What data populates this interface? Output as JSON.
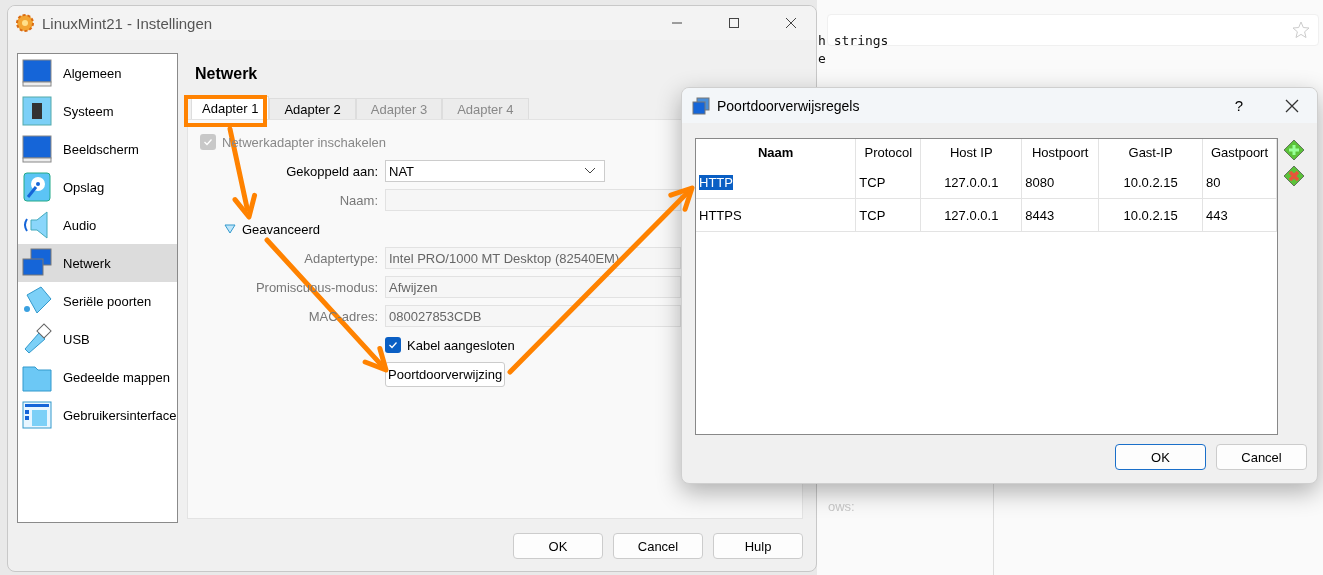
{
  "background": {
    "texts": [
      "h strings",
      "e",
      "ows:"
    ]
  },
  "settings_window": {
    "title": "LinuxMint21 - Instellingen",
    "sidebar": {
      "items": [
        {
          "label": "Algemeen",
          "selected": false
        },
        {
          "label": "Systeem",
          "selected": false
        },
        {
          "label": "Beeldscherm",
          "selected": false
        },
        {
          "label": "Opslag",
          "selected": false
        },
        {
          "label": "Audio",
          "selected": false
        },
        {
          "label": "Netwerk",
          "selected": true
        },
        {
          "label": "Seriële poorten",
          "selected": false
        },
        {
          "label": "USB",
          "selected": false
        },
        {
          "label": "Gedeelde mappen",
          "selected": false
        },
        {
          "label": "Gebruikersinterface",
          "selected": false
        }
      ]
    },
    "section_title": "Netwerk",
    "tabs": [
      {
        "label": "Adapter 1",
        "selected": true,
        "disabled": false
      },
      {
        "label": "Adapter 2",
        "selected": false,
        "disabled": false
      },
      {
        "label": "Adapter 3",
        "selected": false,
        "disabled": true
      },
      {
        "label": "Adapter 4",
        "selected": false,
        "disabled": true
      }
    ],
    "enable_adapter": {
      "label": "Netwerkadapter inschakelen",
      "checked": true,
      "disabled": true
    },
    "fields": [
      {
        "kind": "combo",
        "label": "Gekoppeld aan:",
        "value": "NAT",
        "disabled": false
      },
      {
        "kind": "text",
        "label": "Naam:",
        "disabled": true
      },
      {
        "kind": "expander",
        "label": "Geavanceerd",
        "expanded": true
      },
      {
        "kind": "text",
        "label": "Adaptertype:",
        "value": "Intel PRO/1000 MT Desktop (82540EM)",
        "disabled": true
      },
      {
        "kind": "text",
        "label": "Promiscuous-modus:",
        "value": "Afwijzen",
        "disabled": true
      },
      {
        "kind": "text",
        "label": "MAC-adres:",
        "value": "080027853CDB",
        "disabled": true
      }
    ],
    "cable_connected": {
      "label": "Kabel aangesloten",
      "checked": true
    },
    "port_forwarding_button": "Poortdoorverwijzing",
    "buttons": [
      "OK",
      "Cancel",
      "Hulp"
    ]
  },
  "port_dialog": {
    "title": "Poortdoorverwijsregels",
    "help": "?",
    "table": {
      "columns": [
        "Naam",
        "Protocol",
        "Host IP",
        "Hostpoort",
        "Gast-IP",
        "Gastpoort"
      ],
      "rows": [
        {
          "cells": [
            "HTTP",
            "TCP",
            "127.0.0.1",
            "8080",
            "10.0.2.15",
            "80"
          ],
          "selected": true
        },
        {
          "cells": [
            "HTTPS",
            "TCP",
            "127.0.0.1",
            "8443",
            "10.0.2.15",
            "443"
          ],
          "selected": false
        }
      ]
    },
    "buttons": [
      {
        "label": "OK",
        "default": true
      },
      {
        "label": "Cancel",
        "default": false
      }
    ]
  }
}
